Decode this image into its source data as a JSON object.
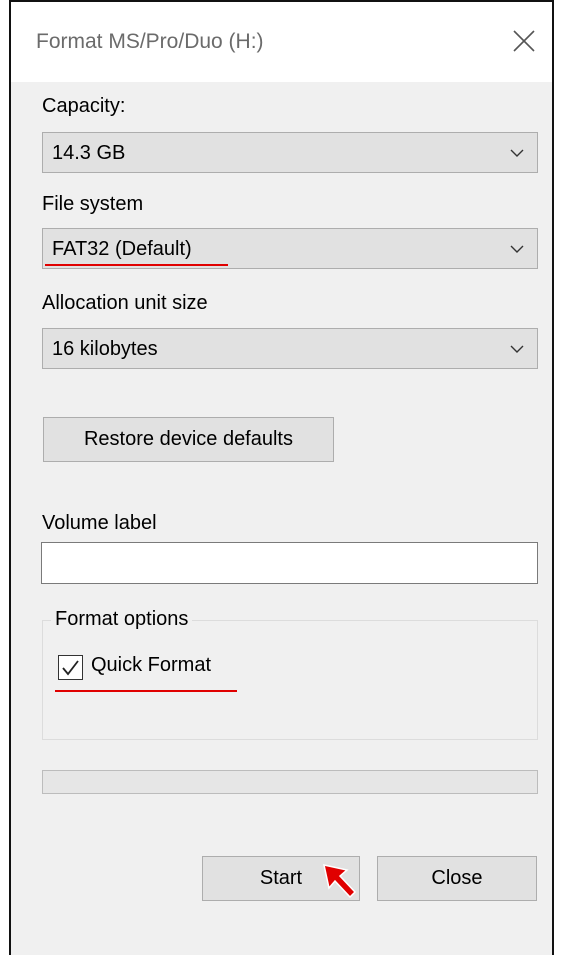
{
  "window": {
    "title": "Format MS/Pro/Duo (H:)"
  },
  "capacity": {
    "label": "Capacity:",
    "value": "14.3 GB"
  },
  "file_system": {
    "label": "File system",
    "value": "FAT32 (Default)"
  },
  "allocation": {
    "label": "Allocation unit size",
    "value": "16 kilobytes"
  },
  "restore_button": {
    "label": "Restore device defaults"
  },
  "volume_label": {
    "label": "Volume label",
    "value": ""
  },
  "format_options": {
    "title": "Format options",
    "quick_format_label": "Quick Format",
    "quick_format_checked": true
  },
  "progress": {
    "fraction": 0
  },
  "buttons": {
    "start": "Start",
    "close": "Close"
  },
  "colors": {
    "annotation_underline": "#e00000",
    "cursor_arrow": "#e00000"
  },
  "icons": {
    "close": "close-icon",
    "dropdown": "chevron-down-icon",
    "check": "checkmark-icon",
    "pointer": "mouse-pointer-icon"
  }
}
